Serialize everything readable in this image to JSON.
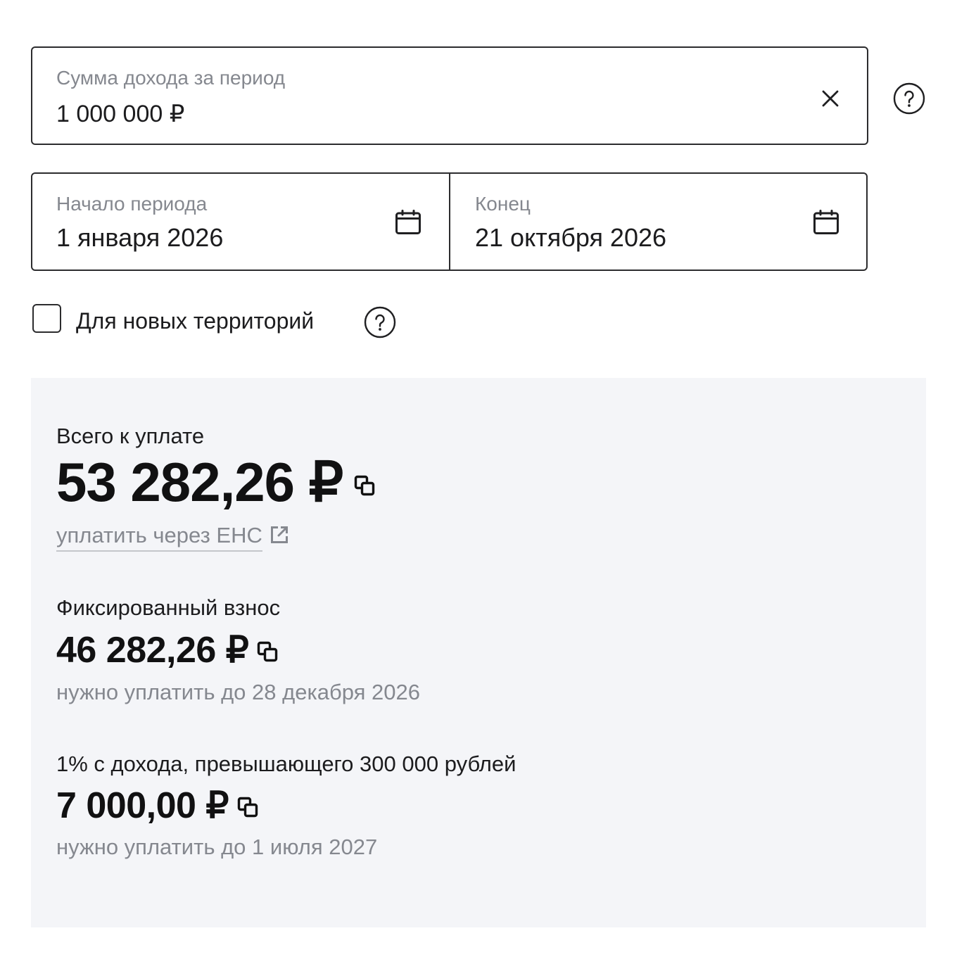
{
  "income": {
    "label": "Сумма дохода за период",
    "value": "1 000 000 ₽"
  },
  "period": {
    "start": {
      "label": "Начало периода",
      "value": "1 января 2026"
    },
    "end": {
      "label": "Конец",
      "value": "21 октября 2026"
    }
  },
  "new_territories": {
    "label": "Для новых территорий",
    "checked": false
  },
  "result": {
    "total": {
      "label": "Всего к уплате",
      "amount": "53 282,26 ₽",
      "pay_link": "уплатить через ЕНС"
    },
    "items": [
      {
        "label": "Фиксированный взнос",
        "amount": "46 282,26 ₽",
        "due": "нужно уплатить до 28 декабря 2026"
      },
      {
        "label": "1% с дохода, превышающего 300 000 рублей",
        "amount": "7 000,00 ₽",
        "due": "нужно уплатить до 1 июля 2027"
      }
    ]
  },
  "icons": {
    "clear": "clear-icon",
    "help": "help-icon",
    "calendar": "calendar-icon",
    "copy": "copy-icon",
    "external_link": "external-link-icon"
  },
  "colors": {
    "text": "#1c1c1e",
    "muted": "#85888f",
    "border": "#2c2c2e",
    "panel": "#f4f5f8"
  }
}
